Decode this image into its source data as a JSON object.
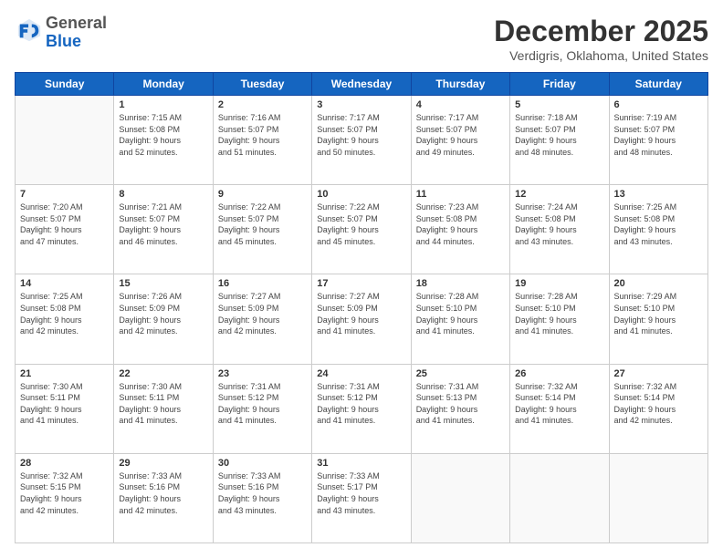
{
  "header": {
    "logo_general": "General",
    "logo_blue": "Blue",
    "month": "December 2025",
    "location": "Verdigris, Oklahoma, United States"
  },
  "weekdays": [
    "Sunday",
    "Monday",
    "Tuesday",
    "Wednesday",
    "Thursday",
    "Friday",
    "Saturday"
  ],
  "weeks": [
    [
      {
        "day": "",
        "info": ""
      },
      {
        "day": "1",
        "info": "Sunrise: 7:15 AM\nSunset: 5:08 PM\nDaylight: 9 hours\nand 52 minutes."
      },
      {
        "day": "2",
        "info": "Sunrise: 7:16 AM\nSunset: 5:07 PM\nDaylight: 9 hours\nand 51 minutes."
      },
      {
        "day": "3",
        "info": "Sunrise: 7:17 AM\nSunset: 5:07 PM\nDaylight: 9 hours\nand 50 minutes."
      },
      {
        "day": "4",
        "info": "Sunrise: 7:17 AM\nSunset: 5:07 PM\nDaylight: 9 hours\nand 49 minutes."
      },
      {
        "day": "5",
        "info": "Sunrise: 7:18 AM\nSunset: 5:07 PM\nDaylight: 9 hours\nand 48 minutes."
      },
      {
        "day": "6",
        "info": "Sunrise: 7:19 AM\nSunset: 5:07 PM\nDaylight: 9 hours\nand 48 minutes."
      }
    ],
    [
      {
        "day": "7",
        "info": "Sunrise: 7:20 AM\nSunset: 5:07 PM\nDaylight: 9 hours\nand 47 minutes."
      },
      {
        "day": "8",
        "info": "Sunrise: 7:21 AM\nSunset: 5:07 PM\nDaylight: 9 hours\nand 46 minutes."
      },
      {
        "day": "9",
        "info": "Sunrise: 7:22 AM\nSunset: 5:07 PM\nDaylight: 9 hours\nand 45 minutes."
      },
      {
        "day": "10",
        "info": "Sunrise: 7:22 AM\nSunset: 5:07 PM\nDaylight: 9 hours\nand 45 minutes."
      },
      {
        "day": "11",
        "info": "Sunrise: 7:23 AM\nSunset: 5:08 PM\nDaylight: 9 hours\nand 44 minutes."
      },
      {
        "day": "12",
        "info": "Sunrise: 7:24 AM\nSunset: 5:08 PM\nDaylight: 9 hours\nand 43 minutes."
      },
      {
        "day": "13",
        "info": "Sunrise: 7:25 AM\nSunset: 5:08 PM\nDaylight: 9 hours\nand 43 minutes."
      }
    ],
    [
      {
        "day": "14",
        "info": "Sunrise: 7:25 AM\nSunset: 5:08 PM\nDaylight: 9 hours\nand 42 minutes."
      },
      {
        "day": "15",
        "info": "Sunrise: 7:26 AM\nSunset: 5:09 PM\nDaylight: 9 hours\nand 42 minutes."
      },
      {
        "day": "16",
        "info": "Sunrise: 7:27 AM\nSunset: 5:09 PM\nDaylight: 9 hours\nand 42 minutes."
      },
      {
        "day": "17",
        "info": "Sunrise: 7:27 AM\nSunset: 5:09 PM\nDaylight: 9 hours\nand 41 minutes."
      },
      {
        "day": "18",
        "info": "Sunrise: 7:28 AM\nSunset: 5:10 PM\nDaylight: 9 hours\nand 41 minutes."
      },
      {
        "day": "19",
        "info": "Sunrise: 7:28 AM\nSunset: 5:10 PM\nDaylight: 9 hours\nand 41 minutes."
      },
      {
        "day": "20",
        "info": "Sunrise: 7:29 AM\nSunset: 5:10 PM\nDaylight: 9 hours\nand 41 minutes."
      }
    ],
    [
      {
        "day": "21",
        "info": "Sunrise: 7:30 AM\nSunset: 5:11 PM\nDaylight: 9 hours\nand 41 minutes."
      },
      {
        "day": "22",
        "info": "Sunrise: 7:30 AM\nSunset: 5:11 PM\nDaylight: 9 hours\nand 41 minutes."
      },
      {
        "day": "23",
        "info": "Sunrise: 7:31 AM\nSunset: 5:12 PM\nDaylight: 9 hours\nand 41 minutes."
      },
      {
        "day": "24",
        "info": "Sunrise: 7:31 AM\nSunset: 5:12 PM\nDaylight: 9 hours\nand 41 minutes."
      },
      {
        "day": "25",
        "info": "Sunrise: 7:31 AM\nSunset: 5:13 PM\nDaylight: 9 hours\nand 41 minutes."
      },
      {
        "day": "26",
        "info": "Sunrise: 7:32 AM\nSunset: 5:14 PM\nDaylight: 9 hours\nand 41 minutes."
      },
      {
        "day": "27",
        "info": "Sunrise: 7:32 AM\nSunset: 5:14 PM\nDaylight: 9 hours\nand 42 minutes."
      }
    ],
    [
      {
        "day": "28",
        "info": "Sunrise: 7:32 AM\nSunset: 5:15 PM\nDaylight: 9 hours\nand 42 minutes."
      },
      {
        "day": "29",
        "info": "Sunrise: 7:33 AM\nSunset: 5:16 PM\nDaylight: 9 hours\nand 42 minutes."
      },
      {
        "day": "30",
        "info": "Sunrise: 7:33 AM\nSunset: 5:16 PM\nDaylight: 9 hours\nand 43 minutes."
      },
      {
        "day": "31",
        "info": "Sunrise: 7:33 AM\nSunset: 5:17 PM\nDaylight: 9 hours\nand 43 minutes."
      },
      {
        "day": "",
        "info": ""
      },
      {
        "day": "",
        "info": ""
      },
      {
        "day": "",
        "info": ""
      }
    ]
  ]
}
